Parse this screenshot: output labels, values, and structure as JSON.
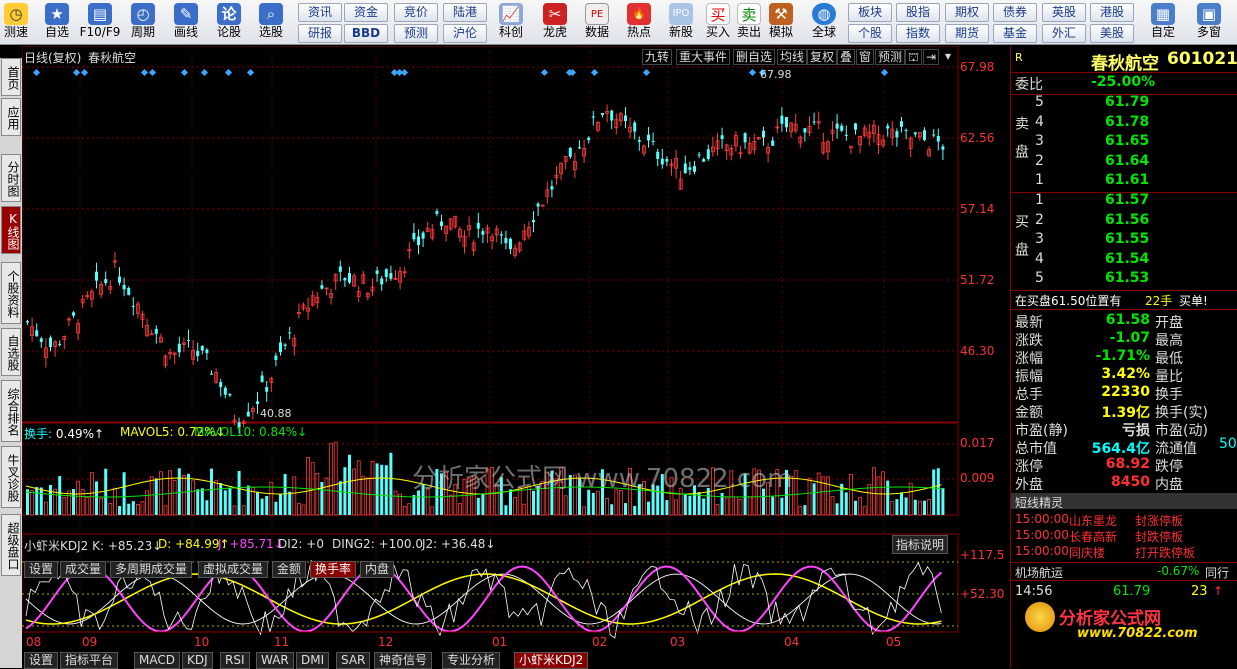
{
  "toolbar": {
    "items": [
      {
        "label": "测速",
        "icon": "speed-test-icon"
      },
      {
        "label": "自选",
        "icon": "favorites-icon"
      },
      {
        "label": "F10/F9",
        "icon": "f10-icon"
      },
      {
        "label": "周期",
        "icon": "clock-icon"
      },
      {
        "label": "画线",
        "icon": "pencil-icon"
      },
      {
        "label": "论股",
        "icon": "forum-icon"
      },
      {
        "label": "选股",
        "icon": "stock-picker-icon"
      }
    ],
    "grid_row1": [
      "资讯",
      "资金",
      "竞价",
      "陆港"
    ],
    "grid_row2": [
      "研报",
      "BBD",
      "预测",
      "沪伦"
    ],
    "items2": [
      {
        "label": "科创",
        "icon": "star-market-icon"
      },
      {
        "label": "龙虎",
        "icon": "dragon-tiger-icon"
      },
      {
        "label": "数据",
        "icon": "data-icon"
      },
      {
        "label": "热点",
        "icon": "hot-icon"
      },
      {
        "label": "新股",
        "icon": "ipo-icon"
      }
    ],
    "buy": "买入",
    "sell": "卖出",
    "sim": "模拟",
    "buy_icon": "买",
    "sell_icon": "卖",
    "global": "全球",
    "grid2_row1": [
      "板块",
      "股指",
      "期权",
      "债券",
      "英股",
      "港股"
    ],
    "grid2_row2": [
      "个股",
      "指数",
      "期货",
      "基金",
      "外汇",
      "美股"
    ],
    "custom": "自定",
    "multi": "多窗"
  },
  "lefttabs": [
    "首页",
    "应用",
    "分时图",
    "K线图",
    "个股资料",
    "自选股",
    "综合排名",
    "牛叉诊股",
    "超级盘口"
  ],
  "chart_header": {
    "period": "日线(复权)",
    "name": "春秋航空"
  },
  "top_buttons": [
    "九转",
    "重大事件",
    "删自选",
    "均线",
    "复权",
    "叠",
    "窗",
    "预测",
    "⛫",
    "⇥"
  ],
  "price_axis": [
    "67.98",
    "62.56",
    "57.14",
    "51.72",
    "46.30"
  ],
  "high_label": "67.98",
  "low_label": "40.88",
  "vol_info": {
    "prefix": "换手:",
    "value": "0.49%↑",
    "ma5": "MAVOL5: 0.72%↓",
    "ma10": "MAVOL10: 0.84%↓"
  },
  "vol_axis": [
    "0.017",
    "0.009"
  ],
  "watermark": "分析家公式网 www.70822.com",
  "vol_tabs": [
    "设置",
    "成交量",
    "多周期成交量",
    "虚拟成交量",
    "金额",
    "换手率",
    "内盘"
  ],
  "kdj_info": {
    "name": "小虾米KDJ2",
    "k": "K: +85.23↓",
    "d": "D: +84.99↑",
    "j": "J: +85.71↓",
    "di2": "DI2: +0",
    "ding2": "DING2: +100.0",
    "j2": "J2: +36.48↓"
  },
  "kdj_axis": [
    "+117.5",
    "+52.30"
  ],
  "indicator_help": "指标说明",
  "months": [
    "08",
    "09",
    "10",
    "11",
    "12",
    "01",
    "02",
    "03",
    "04",
    "05"
  ],
  "bottom_tabs": [
    "设置",
    "指标平台",
    "MACD",
    "KDJ",
    "RSI",
    "WAR",
    "DMI",
    "SAR",
    "神奇信号",
    "专业分析",
    "小虾米KDJ2"
  ],
  "quote": {
    "title": "春秋航空",
    "code": "601021",
    "flag": "R",
    "weibi_label": "委比",
    "weibi": "-25.00%",
    "sell_label": "卖盘",
    "buy_label": "买盘",
    "asks": [
      {
        "lvl": "5",
        "p": "61.79"
      },
      {
        "lvl": "4",
        "p": "61.78"
      },
      {
        "lvl": "3",
        "p": "61.65"
      },
      {
        "lvl": "2",
        "p": "61.64"
      },
      {
        "lvl": "1",
        "p": "61.61"
      }
    ],
    "bids": [
      {
        "lvl": "1",
        "p": "61.57"
      },
      {
        "lvl": "2",
        "p": "61.56"
      },
      {
        "lvl": "3",
        "p": "61.55"
      },
      {
        "lvl": "4",
        "p": "61.54"
      },
      {
        "lvl": "5",
        "p": "61.53"
      }
    ],
    "notice": "在买盘61.50位置有",
    "notice_qty": "22手",
    "notice_act": "买单!",
    "stats": [
      {
        "k": "最新",
        "v": "61.58",
        "k2": "开盘"
      },
      {
        "k": "涨跌",
        "v": "-1.07",
        "k2": "最高"
      },
      {
        "k": "涨幅",
        "v": "-1.71%",
        "k2": "最低"
      },
      {
        "k": "振幅",
        "v": "3.42%",
        "k2": "量比"
      },
      {
        "k": "总手",
        "v": "22330",
        "k2": "换手"
      },
      {
        "k": "金额",
        "v": "1.39亿",
        "k2": "换手(实)"
      },
      {
        "k": "市盈(静)",
        "v": "亏损",
        "k2": "市盈(动)"
      },
      {
        "k": "总市值",
        "v": "564.4亿",
        "k2": "流通值"
      },
      {
        "k": "涨停",
        "v": "68.92",
        "k2": "跌停"
      },
      {
        "k": "外盘",
        "v": "8450",
        "k2": "内盘"
      }
    ],
    "extra_50": "50",
    "elf_title": "短线精灵",
    "elf": [
      {
        "t": "15:00:00",
        "n": "山东墨龙",
        "a": "封涨停板"
      },
      {
        "t": "15:00:00",
        "n": "长春高新",
        "a": "封跌停板"
      },
      {
        "t": "15:00:00",
        "n": "同庆楼",
        "a": "打开跌停板"
      }
    ],
    "sector": "机场航运",
    "sector_chg": "-0.67%",
    "sector_next": "同行",
    "tick_time": "14:56",
    "tick_price": "61.79",
    "tick_vol": "23"
  },
  "logo": {
    "name": "分析家公式网",
    "url": "www.70822.com"
  }
}
